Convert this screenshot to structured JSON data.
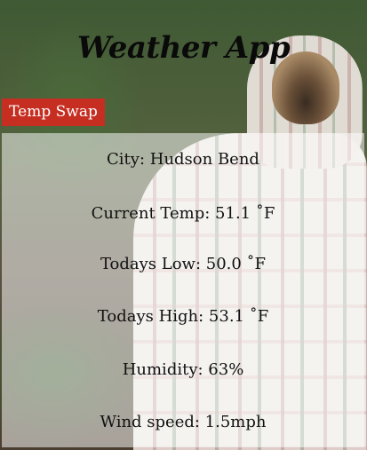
{
  "header": {
    "title": "Weather App"
  },
  "controls": {
    "swap_label": "Temp Swap"
  },
  "weather": {
    "city": "City: Hudson Bend",
    "current": "Current Temp: 51.1 ˚F",
    "low": "Todays Low: 50.0 ˚F",
    "high": "Todays High: 53.1 ˚F",
    "humidity": "Humidity: 63%",
    "wind": "Wind speed: 1.5mph"
  },
  "colors": {
    "swap_button": "#c62e22",
    "panel_overlay": "rgba(255,255,255,0.52)"
  }
}
